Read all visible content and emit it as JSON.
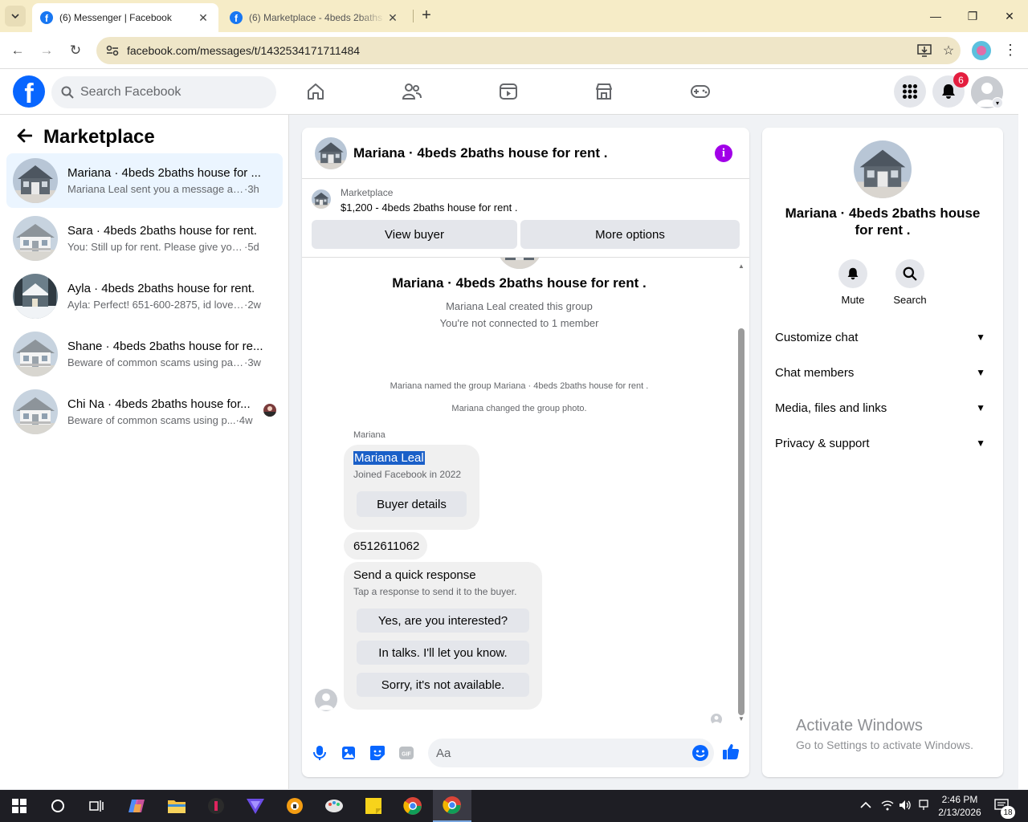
{
  "browser": {
    "tabs": [
      {
        "title": "(6) Messenger | Facebook",
        "active": true
      },
      {
        "title": "(6) Marketplace - 4beds 2baths",
        "active": false
      }
    ],
    "url": "facebook.com/messages/t/1432534171711484"
  },
  "header": {
    "search_placeholder": "Search Facebook",
    "notification_count": "6"
  },
  "left": {
    "title": "Marketplace",
    "conversations": [
      {
        "name": "Mariana · 4beds 2baths house for ...",
        "snippet": "Mariana Leal sent you a message abo...",
        "time": "·3h",
        "selected": true
      },
      {
        "name": "Sara · 4beds 2baths house for rent.",
        "snippet": "You: Still up for rent. Please give your ...",
        "time": "·5d",
        "selected": false
      },
      {
        "name": "Ayla · 4beds 2baths house for rent.",
        "snippet": "Ayla: Perfect! 651-600-2875, id love t...",
        "time": "·2w",
        "selected": false
      },
      {
        "name": "Shane · 4beds 2baths house for re...",
        "snippet": "Beware of common scams using pay...",
        "time": "·3w",
        "selected": false
      },
      {
        "name": "Chi Na · 4beds 2baths house for...",
        "snippet": "Beware of common scams using p...",
        "time": "·4w",
        "selected": false
      }
    ]
  },
  "chat": {
    "title": "Mariana · 4beds 2baths house for rent .",
    "marketplace_label": "Marketplace",
    "listing": "$1,200 - 4beds 2baths house for rent .",
    "view_buyer": "View buyer",
    "more_options": "More options",
    "group_name": "Mariana · 4beds 2baths house for rent .",
    "created": "Mariana Leal created this group",
    "not_connected": "You're not connected to 1 member",
    "event_named": "Mariana named the group Mariana · 4beds 2baths house for rent .",
    "event_photo": "Mariana changed the group photo.",
    "sender": "Mariana",
    "card_name": "Mariana Leal",
    "card_joined": "Joined Facebook in 2022",
    "buyer_details": "Buyer details",
    "phone_msg": "6512611062",
    "quick_title": "Send a quick response",
    "quick_sub": "Tap a response to send it to the buyer.",
    "quick_options": [
      "Yes, are you interested?",
      "In talks. I'll let you know.",
      "Sorry, it's not available."
    ],
    "composer_placeholder": "Aa"
  },
  "right": {
    "title": "Mariana · 4beds 2baths house for rent .",
    "mute": "Mute",
    "search": "Search",
    "sections": [
      "Customize chat",
      "Chat members",
      "Media, files and links",
      "Privacy & support"
    ]
  },
  "watermark": {
    "line1": "Activate Windows",
    "line2": "Go to Settings to activate Windows."
  },
  "taskbar": {
    "time": "2:46 PM",
    "date": "2/13/2026",
    "notif_count": "18"
  },
  "colors": {
    "fb_blue": "#0866ff",
    "selected_bg": "#ebf5ff",
    "info_purple": "#a100e8",
    "badge_red": "#e41e3f"
  }
}
